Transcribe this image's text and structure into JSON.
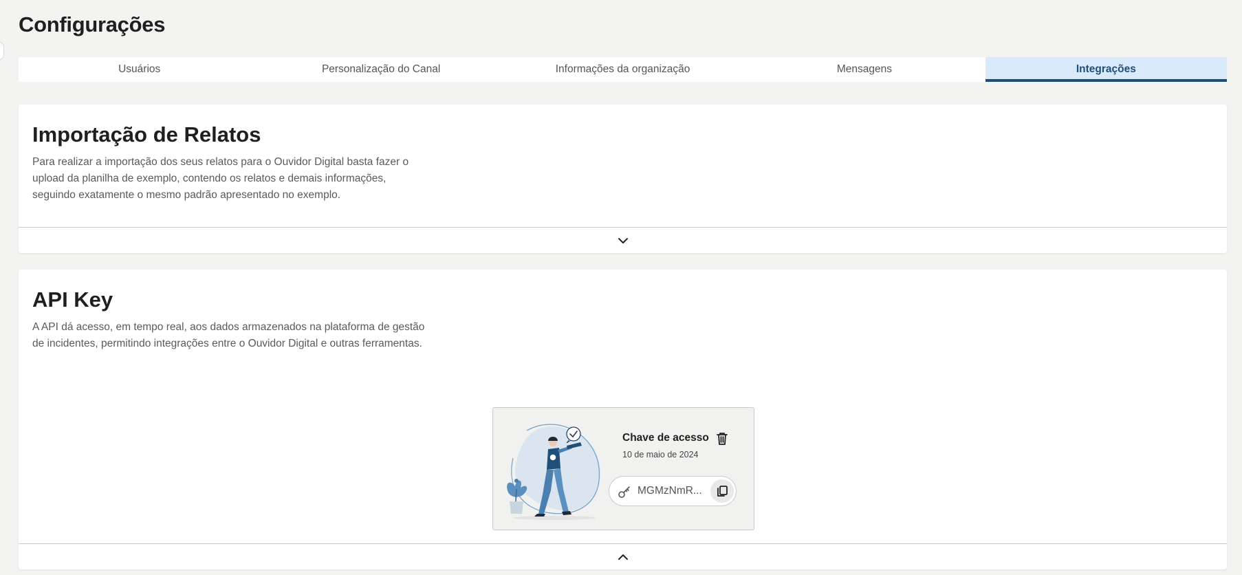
{
  "page": {
    "title": "Configurações"
  },
  "tabs": [
    {
      "label": "Usuários",
      "active": false
    },
    {
      "label": "Personalização do Canal",
      "active": false
    },
    {
      "label": "Informações da organização",
      "active": false
    },
    {
      "label": "Mensagens",
      "active": false
    },
    {
      "label": "Integrações",
      "active": true
    }
  ],
  "import_section": {
    "title": "Importação de Relatos",
    "description": "Para realizar a importação dos seus relatos para o Ouvidor Digital basta fazer o upload da planilha de exemplo, contendo os relatos e demais informações, seguindo exatamente o mesmo padrão apresentado no exemplo.",
    "toggle_icon": "chevron-down-icon"
  },
  "api_section": {
    "title": "API Key",
    "description": "A API dá acesso, em tempo real, aos dados armazenados na plataforma de gestão de incidentes, permitindo integrações entre o Ouvidor Digital e outras ferramentas.",
    "toggle_icon": "chevron-up-icon",
    "key_card": {
      "title": "Chave de acesso",
      "date": "10 de maio de 2024",
      "key_value": "MGMzNmR...",
      "delete_icon": "trash-icon",
      "copy_icon": "copy-icon",
      "key_icon": "key-icon"
    }
  },
  "colors": {
    "accent": "#1f4e79",
    "active_tab_bg": "#d9ebfa",
    "page_bg": "#f3f3f1",
    "illustration_blue": "#4a7fb0"
  }
}
